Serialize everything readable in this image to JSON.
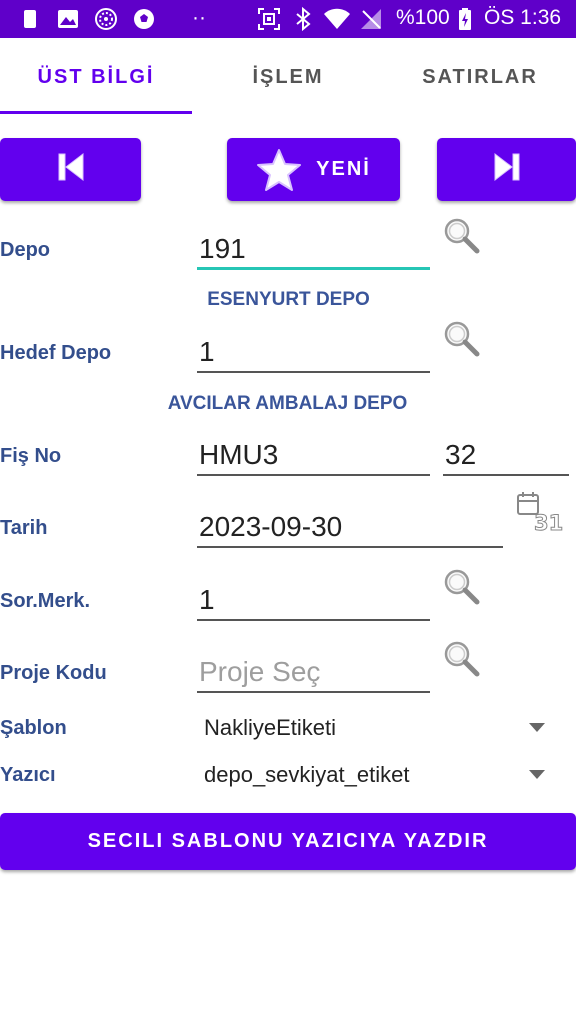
{
  "status_bar": {
    "battery_text": "%100",
    "time": "ÖS 1:36",
    "dots": "··"
  },
  "tabs": [
    {
      "label": "ÜST BİLGİ",
      "active": true
    },
    {
      "label": "İŞLEM",
      "active": false
    },
    {
      "label": "SATIRLAR",
      "active": false
    }
  ],
  "nav": {
    "new_label": "YENİ"
  },
  "form": {
    "depo": {
      "label": "Depo",
      "value": "191",
      "description": "ESENYURT DEPO"
    },
    "hedef_depo": {
      "label": "Hedef Depo",
      "value": "1",
      "description": "AVCILAR AMBALAJ DEPO"
    },
    "fis_no": {
      "label": "Fiş No",
      "series": "HMU3",
      "number": "32"
    },
    "tarih": {
      "label": "Tarih",
      "value": "2023-09-30",
      "calendar_day": "31"
    },
    "sor_merk": {
      "label": "Sor.Merk.",
      "value": "1"
    },
    "proje_kodu": {
      "label": "Proje Kodu",
      "placeholder": "Proje Seç"
    },
    "sablon": {
      "label": "Şablon",
      "selected": "NakliyeEtiketi"
    },
    "yazici": {
      "label": "Yazıcı",
      "selected": "depo_sevkiyat_etiket"
    }
  },
  "print_button": {
    "label": "SECILI SABLONU YAZICIYA YAZDIR"
  },
  "colors": {
    "primary": "#6200ee",
    "status_bar": "#5f00c9",
    "label": "#334e8c",
    "focus_underline": "#26c6b5"
  }
}
